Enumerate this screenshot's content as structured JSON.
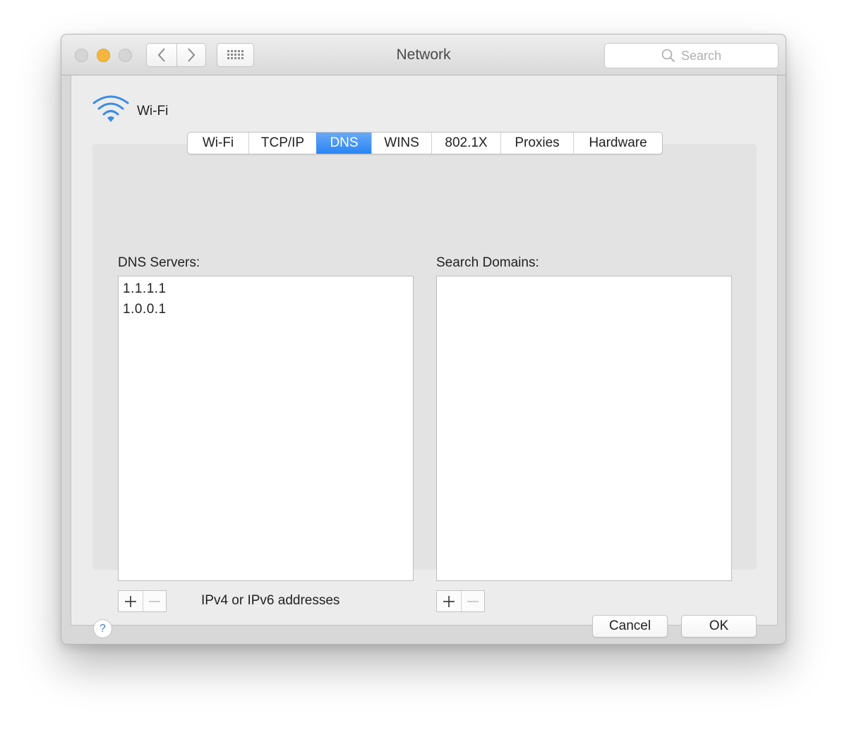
{
  "window": {
    "title": "Network"
  },
  "toolbar": {
    "search_placeholder": "Search"
  },
  "interface": {
    "name": "Wi-Fi",
    "icon": "wifi-icon"
  },
  "tabs": [
    {
      "label": "Wi-Fi",
      "active": false
    },
    {
      "label": "TCP/IP",
      "active": false
    },
    {
      "label": "DNS",
      "active": true
    },
    {
      "label": "WINS",
      "active": false
    },
    {
      "label": "802.1X",
      "active": false
    },
    {
      "label": "Proxies",
      "active": false
    },
    {
      "label": "Hardware",
      "active": false
    }
  ],
  "dns": {
    "label": "DNS Servers:",
    "servers": [
      "1.1.1.1",
      "1.0.0.1"
    ],
    "hint": "IPv4 or IPv6 addresses"
  },
  "search_domains": {
    "label": "Search Domains:",
    "domains": []
  },
  "buttons": {
    "help": "?",
    "cancel": "Cancel",
    "ok": "OK"
  },
  "colors": {
    "accent": "#2a85f4",
    "minimize_light": "#f5b73b",
    "wifi_icon": "#3b8ce6"
  }
}
